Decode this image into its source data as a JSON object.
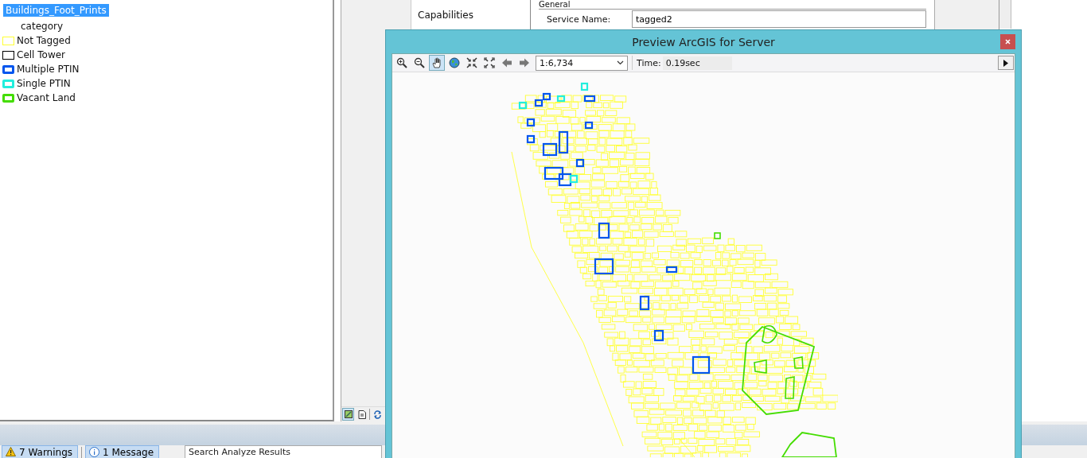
{
  "table_of_contents": {
    "layer": {
      "name": "Buildings_Foot_Prints",
      "selected": true
    },
    "field": "category",
    "legend": [
      {
        "label": "Not Tagged",
        "color": "#ffff33",
        "kind": "thin"
      },
      {
        "label": "Cell Tower",
        "color": "#000000",
        "kind": "thin"
      },
      {
        "label": "Multiple PTIN",
        "color": "#0055ee",
        "kind": "thick"
      },
      {
        "label": "Single PTIN",
        "color": "#22eedd",
        "kind": "thick"
      },
      {
        "label": "Vacant Land",
        "color": "#44dd00",
        "kind": "thick"
      }
    ]
  },
  "service_editor": {
    "sidebar": [
      {
        "label": "Capabilities",
        "selected": false
      }
    ],
    "section": "General",
    "service_name": {
      "label": "Service Name:",
      "value": "tagged2"
    }
  },
  "view_buttons": [
    {
      "kind": "data-view",
      "selected": true
    },
    {
      "kind": "layout-view",
      "selected": false
    },
    {
      "kind": "refresh",
      "selected": false
    }
  ],
  "preview_window": {
    "title": "Preview ArcGIS for Server",
    "tools": [
      {
        "kind": "zoom-in",
        "selected": false
      },
      {
        "kind": "zoom-out",
        "selected": false
      },
      {
        "kind": "pan",
        "selected": true
      },
      {
        "kind": "globe",
        "selected": false
      },
      {
        "kind": "zoom-in-fixed",
        "selected": false
      },
      {
        "kind": "zoom-out-fixed",
        "selected": false
      },
      {
        "kind": "back",
        "selected": false
      },
      {
        "kind": "forward",
        "selected": false
      }
    ],
    "scale": "1:6,734",
    "time_label": "Time:",
    "time_value": "0.19sec"
  },
  "analyze_bar": {
    "tabs": [
      {
        "label": "7 Warnings",
        "kind": "warning",
        "selected": true
      },
      {
        "label": "1 Message",
        "kind": "info",
        "selected": true
      }
    ],
    "search": {
      "placeholder": "Search Analyze Results"
    }
  }
}
